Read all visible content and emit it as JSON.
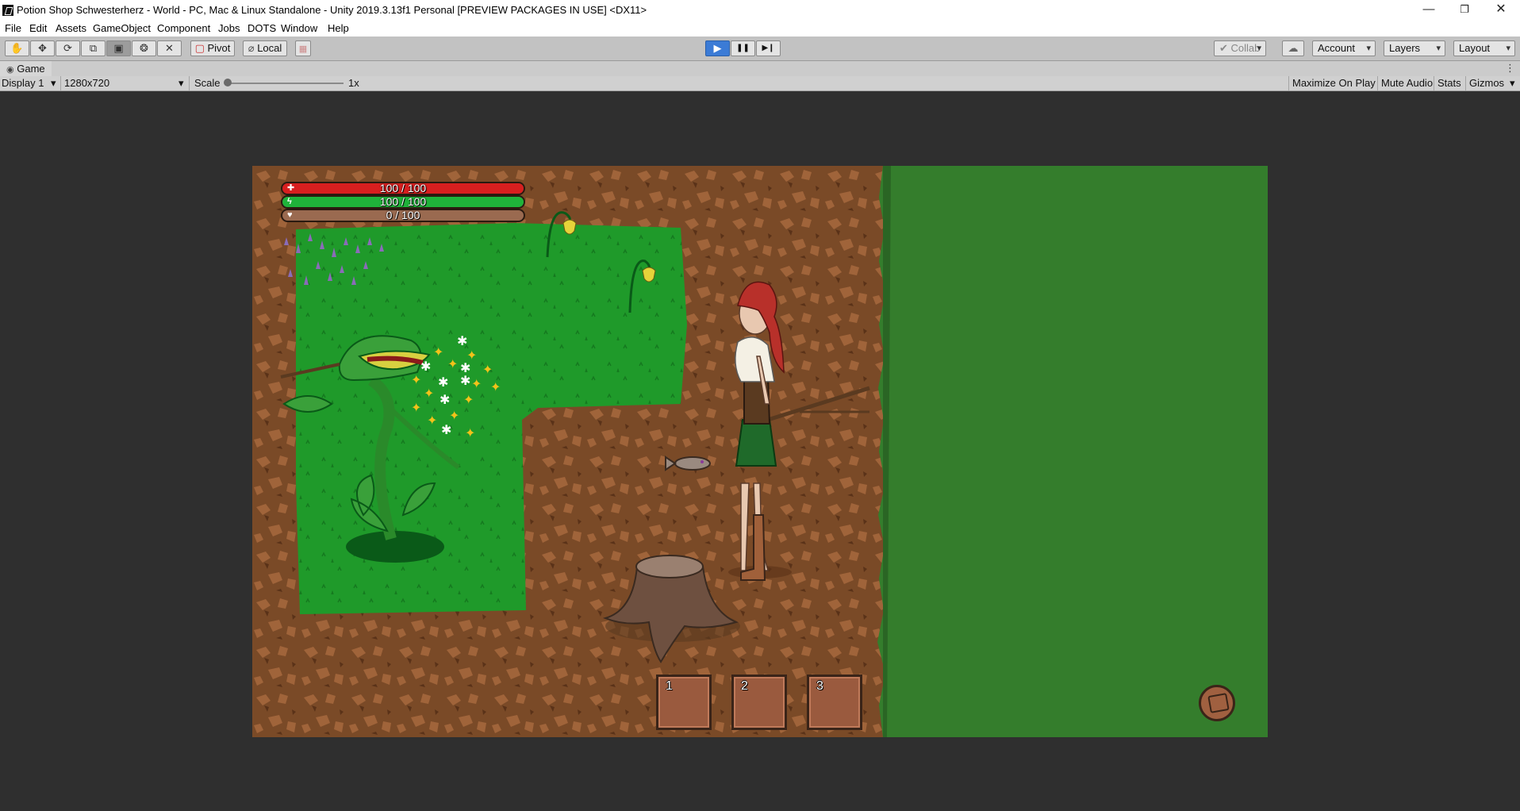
{
  "window": {
    "title": "Potion Shop Schwesterherz - World - PC, Mac & Linux Standalone - Unity 2019.3.13f1 Personal [PREVIEW PACKAGES IN USE] <DX11>",
    "controls": {
      "minimize": "—",
      "restore": "❐",
      "close": "✕"
    }
  },
  "menu": [
    "File",
    "Edit",
    "Assets",
    "GameObject",
    "Component",
    "Jobs",
    "DOTS",
    "Window",
    "Help"
  ],
  "toolbar": {
    "tools": [
      "hand-tool",
      "move-tool",
      "rotate-tool",
      "scale-tool",
      "rect-tool",
      "transform-tool",
      "custom-tool"
    ],
    "pivot_label": "Pivot",
    "local_label": "Local",
    "play_icons": {
      "play": "▶",
      "pause": "❚❚",
      "step": "▶❙"
    },
    "collab_label": "Collab",
    "account_label": "Account",
    "layers_label": "Layers",
    "layout_label": "Layout"
  },
  "game_tab": {
    "label": "Game"
  },
  "game_controls": {
    "display": "Display 1",
    "resolution": "1280x720",
    "scale_label": "Scale",
    "scale_value": "1x",
    "maximize_on_play": "Maximize On Play",
    "mute_audio": "Mute Audio",
    "stats": "Stats",
    "gizmos": "Gizmos"
  },
  "hud": {
    "health": {
      "text": "100 / 100",
      "value": 100,
      "max": 100,
      "color": "#d81f1f",
      "icon": "health-cross-icon"
    },
    "stamina": {
      "text": "100 / 100",
      "value": 100,
      "max": 100,
      "color": "#1fb33a",
      "icon": "lightning-icon"
    },
    "affection": {
      "text": "0 / 100",
      "value": 0,
      "max": 100,
      "color": "#c07a5a",
      "icon": "heart-icon"
    }
  },
  "hotbar": {
    "slots": [
      "1",
      "2",
      "3"
    ]
  },
  "colors": {
    "dirt": "#7a4a27",
    "grass": "#1f9a2a",
    "dark_grass": "#347d2c",
    "play_active": "#3b7bd6"
  }
}
